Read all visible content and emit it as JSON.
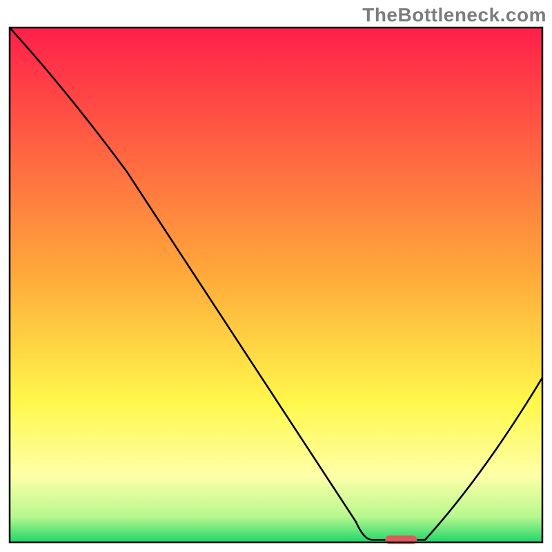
{
  "watermark": "TheBottleneck.com",
  "chart_data": {
    "type": "line",
    "x_range": [
      0,
      100
    ],
    "y_range": [
      0,
      100
    ],
    "line_1": {
      "description": "descending curve from top-left toward bottom-right with slight knee",
      "points": [
        {
          "x": 0,
          "y": 100
        },
        {
          "x": 22,
          "y": 72
        },
        {
          "x": 65,
          "y": 4
        },
        {
          "x": 68,
          "y": 0.5
        }
      ]
    },
    "flat_segment": {
      "description": "near-zero flat segment along bottom axis",
      "points": [
        {
          "x": 68,
          "y": 0.5
        },
        {
          "x": 78,
          "y": 0.5
        }
      ]
    },
    "line_2": {
      "description": "ascending curve from bottom toward upper-right",
      "points": [
        {
          "x": 78,
          "y": 0.5
        },
        {
          "x": 100,
          "y": 32
        }
      ]
    },
    "marker": {
      "description": "red pill-shaped highlight at the minimum",
      "x": 73.5,
      "y": 0.5,
      "width": 6,
      "height": 1.6,
      "color": "#e0595c"
    },
    "background_gradient_stops": [
      {
        "offset": 0.0,
        "color": "#ff1f4a"
      },
      {
        "offset": 0.48,
        "color": "#ffa93a"
      },
      {
        "offset": 0.73,
        "color": "#fff84c"
      },
      {
        "offset": 0.87,
        "color": "#feffa8"
      },
      {
        "offset": 0.95,
        "color": "#b7f88e"
      },
      {
        "offset": 1.0,
        "color": "#1fd56a"
      }
    ],
    "axes": {
      "border_width_px": 2.5,
      "has_ticks": false,
      "has_labels": false
    }
  }
}
